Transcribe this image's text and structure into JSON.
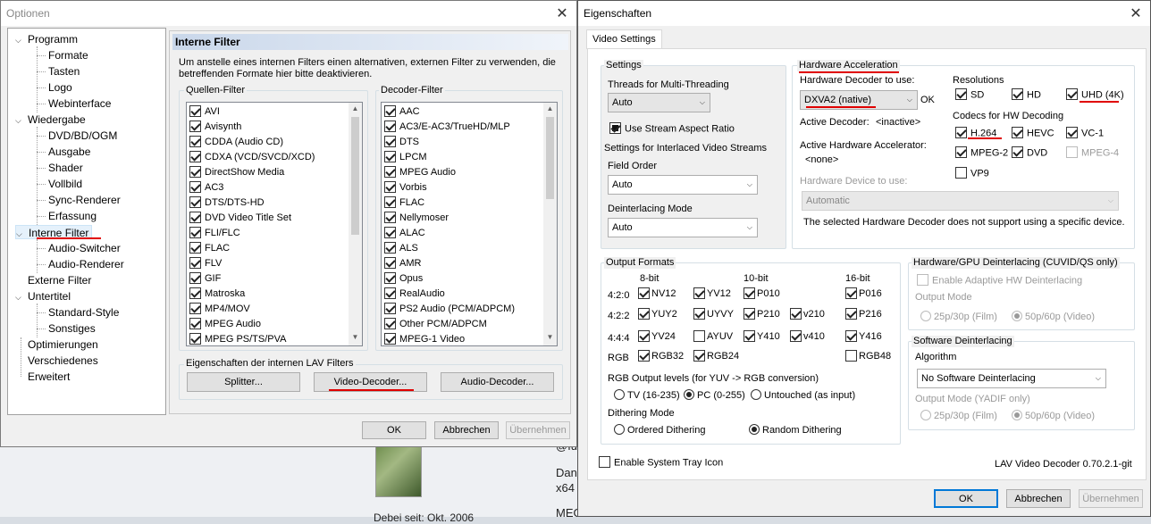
{
  "background": {
    "snippets": [
      "@fu",
      "Dank",
      "x64",
      "MEG",
      "Debei seit: Okt. 2006"
    ]
  },
  "optionen": {
    "title": "Optionen",
    "tree": [
      {
        "label": "Programm",
        "level": 0,
        "expander": "v"
      },
      {
        "label": "Formate",
        "level": 1
      },
      {
        "label": "Tasten",
        "level": 1
      },
      {
        "label": "Logo",
        "level": 1
      },
      {
        "label": "Webinterface",
        "level": 1
      },
      {
        "label": "Wiedergabe",
        "level": 0,
        "expander": "v"
      },
      {
        "label": "DVD/BD/OGM",
        "level": 1
      },
      {
        "label": "Ausgabe",
        "level": 1
      },
      {
        "label": "Shader",
        "level": 1
      },
      {
        "label": "Vollbild",
        "level": 1
      },
      {
        "label": "Sync-Renderer",
        "level": 1
      },
      {
        "label": "Erfassung",
        "level": 1
      },
      {
        "label": "Interne Filter",
        "level": 0,
        "expander": "v",
        "selected": true
      },
      {
        "label": "Audio-Switcher",
        "level": 1
      },
      {
        "label": "Audio-Renderer",
        "level": 1
      },
      {
        "label": "Externe Filter",
        "level": 0
      },
      {
        "label": "Untertitel",
        "level": 0,
        "expander": "v"
      },
      {
        "label": "Standard-Style",
        "level": 1
      },
      {
        "label": "Sonstiges",
        "level": 1
      },
      {
        "label": "Optimierungen",
        "level": 0
      },
      {
        "label": "Verschiedenes",
        "level": 0
      },
      {
        "label": "Erweitert",
        "level": 0
      }
    ],
    "panel_title": "Interne Filter",
    "description": "Um anstelle eines internen Filters einen alternativen, externen Filter zu verwenden, die betreffenden Formate hier bitte deaktivieren.",
    "source_filter_label": "Quellen-Filter",
    "source_filters": [
      "AVI",
      "Avisynth",
      "CDDA (Audio CD)",
      "CDXA (VCD/SVCD/XCD)",
      "DirectShow Media",
      "AC3",
      "DTS/DTS-HD",
      "DVD Video Title Set",
      "FLI/FLC",
      "FLAC",
      "FLV",
      "GIF",
      "Matroska",
      "MP4/MOV",
      "MPEG Audio",
      "MPEG PS/TS/PVA"
    ],
    "decoder_filter_label": "Decoder-Filter",
    "decoder_filters": [
      "AAC",
      "AC3/E-AC3/TrueHD/MLP",
      "DTS",
      "LPCM",
      "MPEG Audio",
      "Vorbis",
      "FLAC",
      "Nellymoser",
      "ALAC",
      "ALS",
      "AMR",
      "Opus",
      "RealAudio",
      "PS2 Audio (PCM/ADPCM)",
      "Other PCM/ADPCM",
      "MPEG-1 Video"
    ],
    "lav_group_label": "Eigenschaften der internen LAV Filters",
    "splitter_btn": "Splitter...",
    "video_decoder_btn": "Video-Decoder...",
    "audio_decoder_btn": "Audio-Decoder...",
    "ok_btn": "OK",
    "cancel_btn": "Abbrechen",
    "apply_btn": "Übernehmen"
  },
  "eigenschaften": {
    "title": "Eigenschaften",
    "tab_label": "Video Settings",
    "settings": {
      "label": "Settings",
      "threads_label": "Threads for Multi-Threading",
      "threads_value": "Auto",
      "stream_aspect_label": "Use Stream Aspect Ratio",
      "stream_aspect_checked": true,
      "interlaced_label": "Settings for Interlaced Video Streams",
      "field_order_label": "Field Order",
      "field_order_value": "Auto",
      "deint_mode_label": "Deinterlacing Mode",
      "deint_mode_value": "Auto"
    },
    "hwaccel": {
      "label": "Hardware Acceleration",
      "decoder_label": "Hardware Decoder to use:",
      "decoder_value": "DXVA2 (native)",
      "ok_text": "OK",
      "active_decoder_label": "Active Decoder:",
      "active_decoder_value": "<inactive>",
      "active_accel_label": "Active Hardware Accelerator:",
      "active_accel_value": "<none>",
      "device_label": "Hardware Device to use:",
      "device_value": "Automatic",
      "note": "The selected Hardware Decoder does not support using a specific device.",
      "resolutions_label": "Resolutions",
      "resolutions": [
        {
          "label": "SD",
          "checked": true
        },
        {
          "label": "HD",
          "checked": true
        },
        {
          "label": "UHD (4K)",
          "checked": true
        }
      ],
      "codecs_label": "Codecs for HW Decoding",
      "codecs": [
        {
          "label": "H.264",
          "checked": true,
          "enabled": true
        },
        {
          "label": "HEVC",
          "checked": true,
          "enabled": true
        },
        {
          "label": "VC-1",
          "checked": true,
          "enabled": true
        },
        {
          "label": "MPEG-2",
          "checked": true,
          "enabled": true
        },
        {
          "label": "DVD",
          "checked": true,
          "enabled": true
        },
        {
          "label": "MPEG-4",
          "checked": false,
          "enabled": false
        },
        {
          "label": "VP9",
          "checked": false,
          "enabled": true
        }
      ]
    },
    "output": {
      "label": "Output Formats",
      "col_headers": [
        "8-bit",
        "10-bit",
        "16-bit"
      ],
      "rows": [
        {
          "label": "4:2:0",
          "items": [
            {
              "label": "NV12",
              "checked": true
            },
            {
              "label": "YV12",
              "checked": true
            },
            {
              "label": "P010",
              "checked": true
            },
            {
              "label": "",
              "checked": false,
              "hidden": true
            },
            {
              "label": "P016",
              "checked": true
            }
          ]
        },
        {
          "label": "4:2:2",
          "items": [
            {
              "label": "YUY2",
              "checked": true
            },
            {
              "label": "UYVY",
              "checked": true
            },
            {
              "label": "P210",
              "checked": true
            },
            {
              "label": "v210",
              "checked": true
            },
            {
              "label": "P216",
              "checked": true
            }
          ]
        },
        {
          "label": "4:4:4",
          "items": [
            {
              "label": "YV24",
              "checked": true
            },
            {
              "label": "AYUV",
              "checked": false
            },
            {
              "label": "Y410",
              "checked": true
            },
            {
              "label": "v410",
              "checked": true
            },
            {
              "label": "Y416",
              "checked": true
            }
          ]
        },
        {
          "label": "RGB",
          "items": [
            {
              "label": "RGB32",
              "checked": true
            },
            {
              "label": "RGB24",
              "checked": true
            },
            {
              "label": "",
              "checked": false,
              "hidden": true
            },
            {
              "label": "",
              "checked": false,
              "hidden": true
            },
            {
              "label": "RGB48",
              "checked": false
            }
          ]
        }
      ],
      "rgb_levels_label": "RGB Output levels (for YUV -> RGB conversion)",
      "rgb_levels": [
        {
          "label": "TV (16-235)",
          "selected": false
        },
        {
          "label": "PC (0-255)",
          "selected": true
        },
        {
          "label": "Untouched (as input)",
          "selected": false
        }
      ],
      "dither_label": "Dithering Mode",
      "dither": [
        {
          "label": "Ordered Dithering",
          "selected": false
        },
        {
          "label": "Random Dithering",
          "selected": true
        }
      ]
    },
    "hwdeint": {
      "label": "Hardware/GPU Deinterlacing (CUVID/QS only)",
      "adaptive_label": "Enable Adaptive HW Deinterlacing",
      "output_mode_label": "Output Mode",
      "mode_25": "25p/30p (Film)",
      "mode_50": "50p/60p (Video)"
    },
    "swdeint": {
      "label": "Software Deinterlacing",
      "algo_label": "Algorithm",
      "algo_value": "No Software Deinterlacing",
      "output_mode_label": "Output Mode (YADIF only)",
      "mode_25": "25p/30p (Film)",
      "mode_50": "50p/60p (Video)"
    },
    "tray_label": "Enable System Tray Icon",
    "version": "LAV Video Decoder 0.70.2.1-git",
    "ok_btn": "OK",
    "cancel_btn": "Abbrechen",
    "apply_btn": "Übernehmen"
  }
}
